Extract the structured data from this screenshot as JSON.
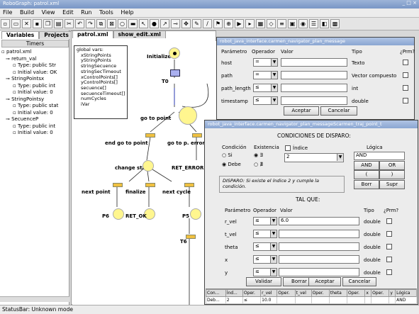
{
  "window": {
    "title": "RoboGraph: patrol.xml"
  },
  "menu": [
    "File",
    "Build",
    "View",
    "Edit",
    "Run",
    "Tools",
    "Help"
  ],
  "left_panel": {
    "tabs": [
      "Variables",
      "Projects"
    ],
    "header": "Timers",
    "tree": [
      "patrol.xml",
      "return_val",
      "Type: public Str",
      "Initial value: OK",
      "StringPointsx",
      "Type: public int",
      "Initial value: 0",
      "StringPointsy",
      "Type: public stat",
      "Initial value: 0",
      "SecuenceP",
      "Type: public int",
      "Initial value: 0"
    ]
  },
  "editor": {
    "tabs": [
      "patrol.xml",
      "show_edit.xml"
    ],
    "vars_title": "global vars:",
    "vars": [
      "xStringPoints",
      "yStringPoints",
      "stringSecuence",
      "stringSecTimeout",
      "xControlPoints[]",
      "yControlPoints[]",
      "secuence[]",
      "secuenceTimeout[]",
      "numCycles",
      "iVar"
    ],
    "nodes": {
      "initialize": "Initialize",
      "t0": "T0",
      "goto_point": "go to point",
      "end_goto": "end go to point",
      "goto_p_error": "go to p. error",
      "change_stat": "change stat",
      "ret_error": "RET_ERROR",
      "next_point": "next point",
      "finalize": "finalize",
      "next_cycle": "next cycle",
      "p6": "P6",
      "ret_ok": "RET_OK",
      "p5": "P5",
      "t6": "T6"
    }
  },
  "dialog1": {
    "title": "robot_java_interface.carmen_navigator_plan_message",
    "headers": [
      "Parámetro",
      "Operador",
      "Valor",
      "Tipo",
      "¿Prm?"
    ],
    "rows": [
      {
        "param": "host",
        "op": "=",
        "type": "Texto"
      },
      {
        "param": "path",
        "op": "=",
        "type": "Vector compuesto"
      },
      {
        "param": "path_length",
        "op": "≤",
        "type": "int"
      },
      {
        "param": "timestamp",
        "op": "≤",
        "type": "double"
      }
    ],
    "ok": "Aceptar",
    "cancel": "Cancelar"
  },
  "dialog2": {
    "title": "robot_java_interface.carmen_navigator_plan_messageScarmen_traj_point_t",
    "heading": "CONDICIONES DE DISPARO:",
    "condicion_label": "Condición",
    "condicion_opts": [
      "Si",
      "Debe"
    ],
    "existencia_label": "Existencia",
    "existencia_opts": [
      "∃",
      "∄"
    ],
    "indice_label": "Índice",
    "indice_value": "2",
    "logica_label": "Lógica",
    "logica_value": "AND",
    "logic_buttons": [
      "AND",
      "OR",
      "(",
      ")",
      "Borr",
      "Supr"
    ],
    "disparo_text": "DISPARO: Si existe el índice 2 y cumple la condición.",
    "tal_que": "TAL QUE:",
    "headers": [
      "Parámetro",
      "Operador",
      "Valor",
      "Tipo",
      "¿Prm?"
    ],
    "rows": [
      {
        "param": "r_vel",
        "op": "≤",
        "value": "6.0",
        "type": "double"
      },
      {
        "param": "t_vel",
        "op": "≤",
        "value": "",
        "type": "double"
      },
      {
        "param": "theta",
        "op": "≤",
        "value": "",
        "type": "double"
      },
      {
        "param": "x",
        "op": "≤",
        "value": "",
        "type": "double"
      },
      {
        "param": "y",
        "op": "≤",
        "value": "",
        "type": "double"
      }
    ],
    "buttons": [
      "Validar",
      "Borrar",
      "Aceptar",
      "Cancelar"
    ],
    "table_headers": [
      "Con...",
      "Índ...",
      "Oper.",
      "r_vel",
      "Oper.",
      "t_vel",
      "Oper.",
      "theta",
      "Oper.",
      "x",
      "Oper.",
      "y",
      "Lógica"
    ],
    "table_row": [
      "Deb...",
      "2",
      "≤",
      "10.0",
      "",
      "",
      "",
      "",
      "",
      "",
      "",
      "",
      "AND"
    ]
  },
  "statusbar": "StatusBar: Unknown mode"
}
